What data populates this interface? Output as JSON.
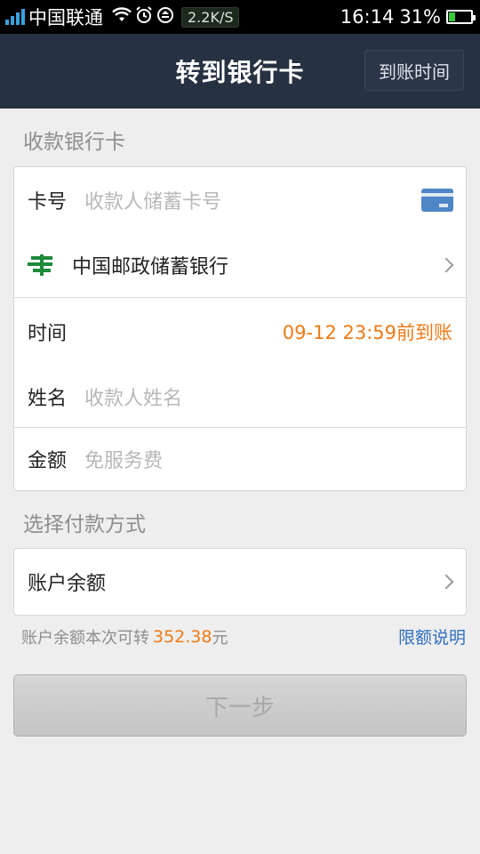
{
  "status_bar": {
    "carrier": "中国联通",
    "net_speed": "2.2K/S",
    "time": "16:14",
    "battery": "31%",
    "battery_level": 0.31
  },
  "header": {
    "title": "转到银行卡",
    "arrival_time_button": "到账时间"
  },
  "receiving_card": {
    "section_label": "收款银行卡",
    "card_number_label": "卡号",
    "card_number_placeholder": "收款人储蓄卡号",
    "bank_name": "中国邮政储蓄银行",
    "time_label": "时间",
    "time_value": "09-12 23:59前到账",
    "name_label": "姓名",
    "name_placeholder": "收款人姓名",
    "amount_label": "金额",
    "amount_placeholder": "免服务费"
  },
  "payment": {
    "section_label": "选择付款方式",
    "method": "账户余额",
    "info_text": "账户余额本次可转",
    "available_amount": "352.38",
    "currency_unit": "元",
    "limit_link": "限额说明"
  },
  "next_button": "下一步",
  "colors": {
    "header_bg": "#263142",
    "accent_orange": "#ee7a16",
    "link_blue": "#2f6fc0"
  }
}
